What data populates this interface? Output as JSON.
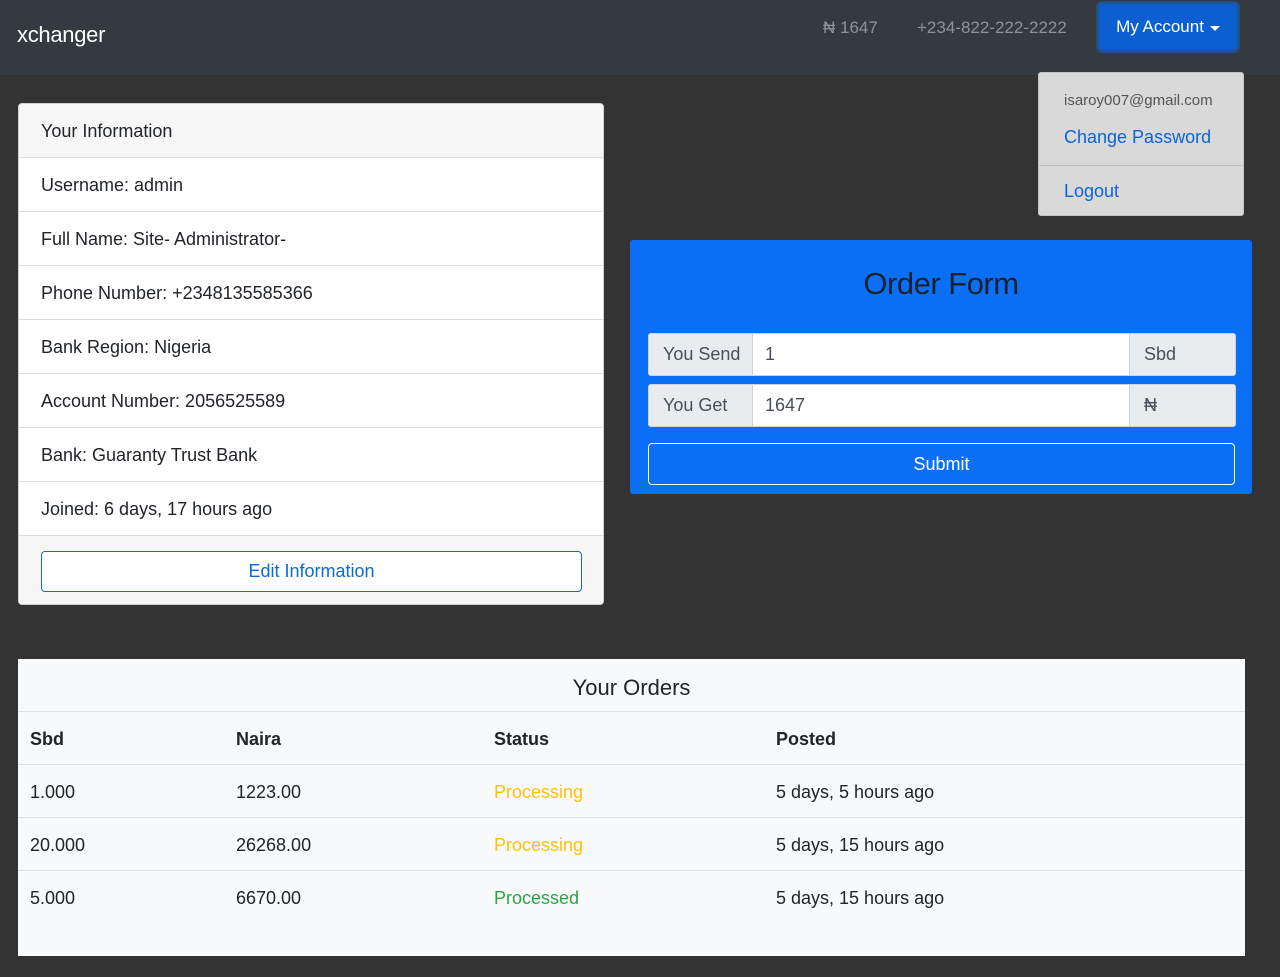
{
  "navbar": {
    "brand": "xchanger",
    "balance": "₦ 1647",
    "phone": "+234-822-222-2222",
    "account_label": "My Account"
  },
  "dropdown": {
    "email": "isaroy007@gmail.com",
    "change_password": "Change Password",
    "logout": "Logout"
  },
  "info": {
    "header": "Your Information",
    "rows": [
      "Username: admin",
      "Full Name: Site- Administrator-",
      "Phone Number: +2348135585366",
      "Bank Region: Nigeria",
      "Account Number: 2056525589",
      "Bank: Guaranty Trust Bank",
      "Joined: 6 days, 17 hours ago"
    ],
    "edit_label": "Edit Information"
  },
  "order_form": {
    "title": "Order Form",
    "send_label": "You Send",
    "send_value": "1",
    "send_currency": "Sbd",
    "get_label": "You Get",
    "get_value": "1647",
    "get_currency": "₦",
    "submit_label": "Submit"
  },
  "orders": {
    "title": "Your Orders",
    "columns": [
      "Sbd",
      "Naira",
      "Status",
      "Posted"
    ],
    "rows": [
      {
        "sbd": "1.000",
        "naira": "1223.00",
        "status": "Processing",
        "posted": "5 days, 5 hours ago"
      },
      {
        "sbd": "20.000",
        "naira": "26268.00",
        "status": "Processing",
        "posted": "5 days, 15 hours ago"
      },
      {
        "sbd": "5.000",
        "naira": "6670.00",
        "status": "Processed",
        "posted": "5 days, 15 hours ago"
      }
    ]
  },
  "colors": {
    "navbar_bg": "#343a40",
    "page_bg": "#333333",
    "primary": "#0a6ff5",
    "status_processing": "#ffc107",
    "status_processed": "#28a745"
  }
}
